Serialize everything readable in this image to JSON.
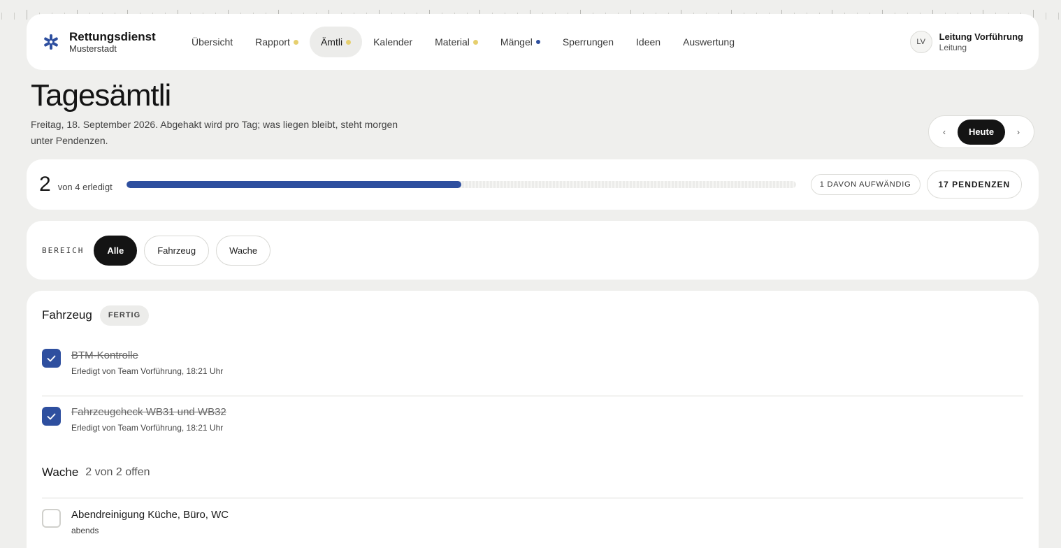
{
  "brand": {
    "title": "Rettungsdienst",
    "subtitle": "Musterstadt"
  },
  "nav": [
    {
      "label": "Übersicht",
      "dot": null,
      "active": false
    },
    {
      "label": "Rapport",
      "dot": "yellow",
      "active": false
    },
    {
      "label": "Ämtli",
      "dot": "yellow",
      "active": true
    },
    {
      "label": "Kalender",
      "dot": null,
      "active": false
    },
    {
      "label": "Material",
      "dot": "yellow",
      "active": false
    },
    {
      "label": "Mängel",
      "dot": "blue",
      "active": false
    },
    {
      "label": "Sperrungen",
      "dot": null,
      "active": false
    },
    {
      "label": "Ideen",
      "dot": null,
      "active": false
    },
    {
      "label": "Auswertung",
      "dot": null,
      "active": false
    }
  ],
  "user": {
    "initials": "LV",
    "name": "Leitung Vorführung",
    "role": "Leitung"
  },
  "page": {
    "title": "Tagesämtli",
    "description": "Freitag, 18. September 2026. Abgehakt wird pro Tag; was liegen bleibt, steht morgen unter Pendenzen."
  },
  "daynav": {
    "prev": "‹",
    "today": "Heute",
    "next": "›"
  },
  "progress": {
    "done": "2",
    "label": "von 4 erledigt",
    "fraction": 0.5,
    "effort_pill": "1 DAVON AUFWÄNDIG",
    "pending_pill": "17 PENDENZEN"
  },
  "filter": {
    "label": "BEREICH",
    "chips": [
      {
        "label": "Alle",
        "active": true
      },
      {
        "label": "Fahrzeug",
        "active": false
      },
      {
        "label": "Wache",
        "active": false
      }
    ]
  },
  "sections": {
    "vehicle": {
      "title": "Fahrzeug",
      "badge": "FERTIG",
      "tasks": [
        {
          "title": "BTM-Kontrolle",
          "meta": "Erledigt von Team Vorführung, 18:21 Uhr",
          "done": true
        },
        {
          "title": "Fahrzeugcheck WB31 und WB32",
          "meta": "Erledigt von Team Vorführung, 18:21 Uhr",
          "done": true
        }
      ]
    },
    "station": {
      "title": "Wache",
      "count": "2 von 2 offen",
      "tasks": [
        {
          "title": "Abendreinigung Küche, Büro, WC",
          "meta": "abends",
          "done": false
        }
      ]
    }
  },
  "colors": {
    "accent": "#2e4f9f",
    "dot_yellow": "#e6cf6e",
    "dark": "#141414",
    "background": "#efefed"
  }
}
